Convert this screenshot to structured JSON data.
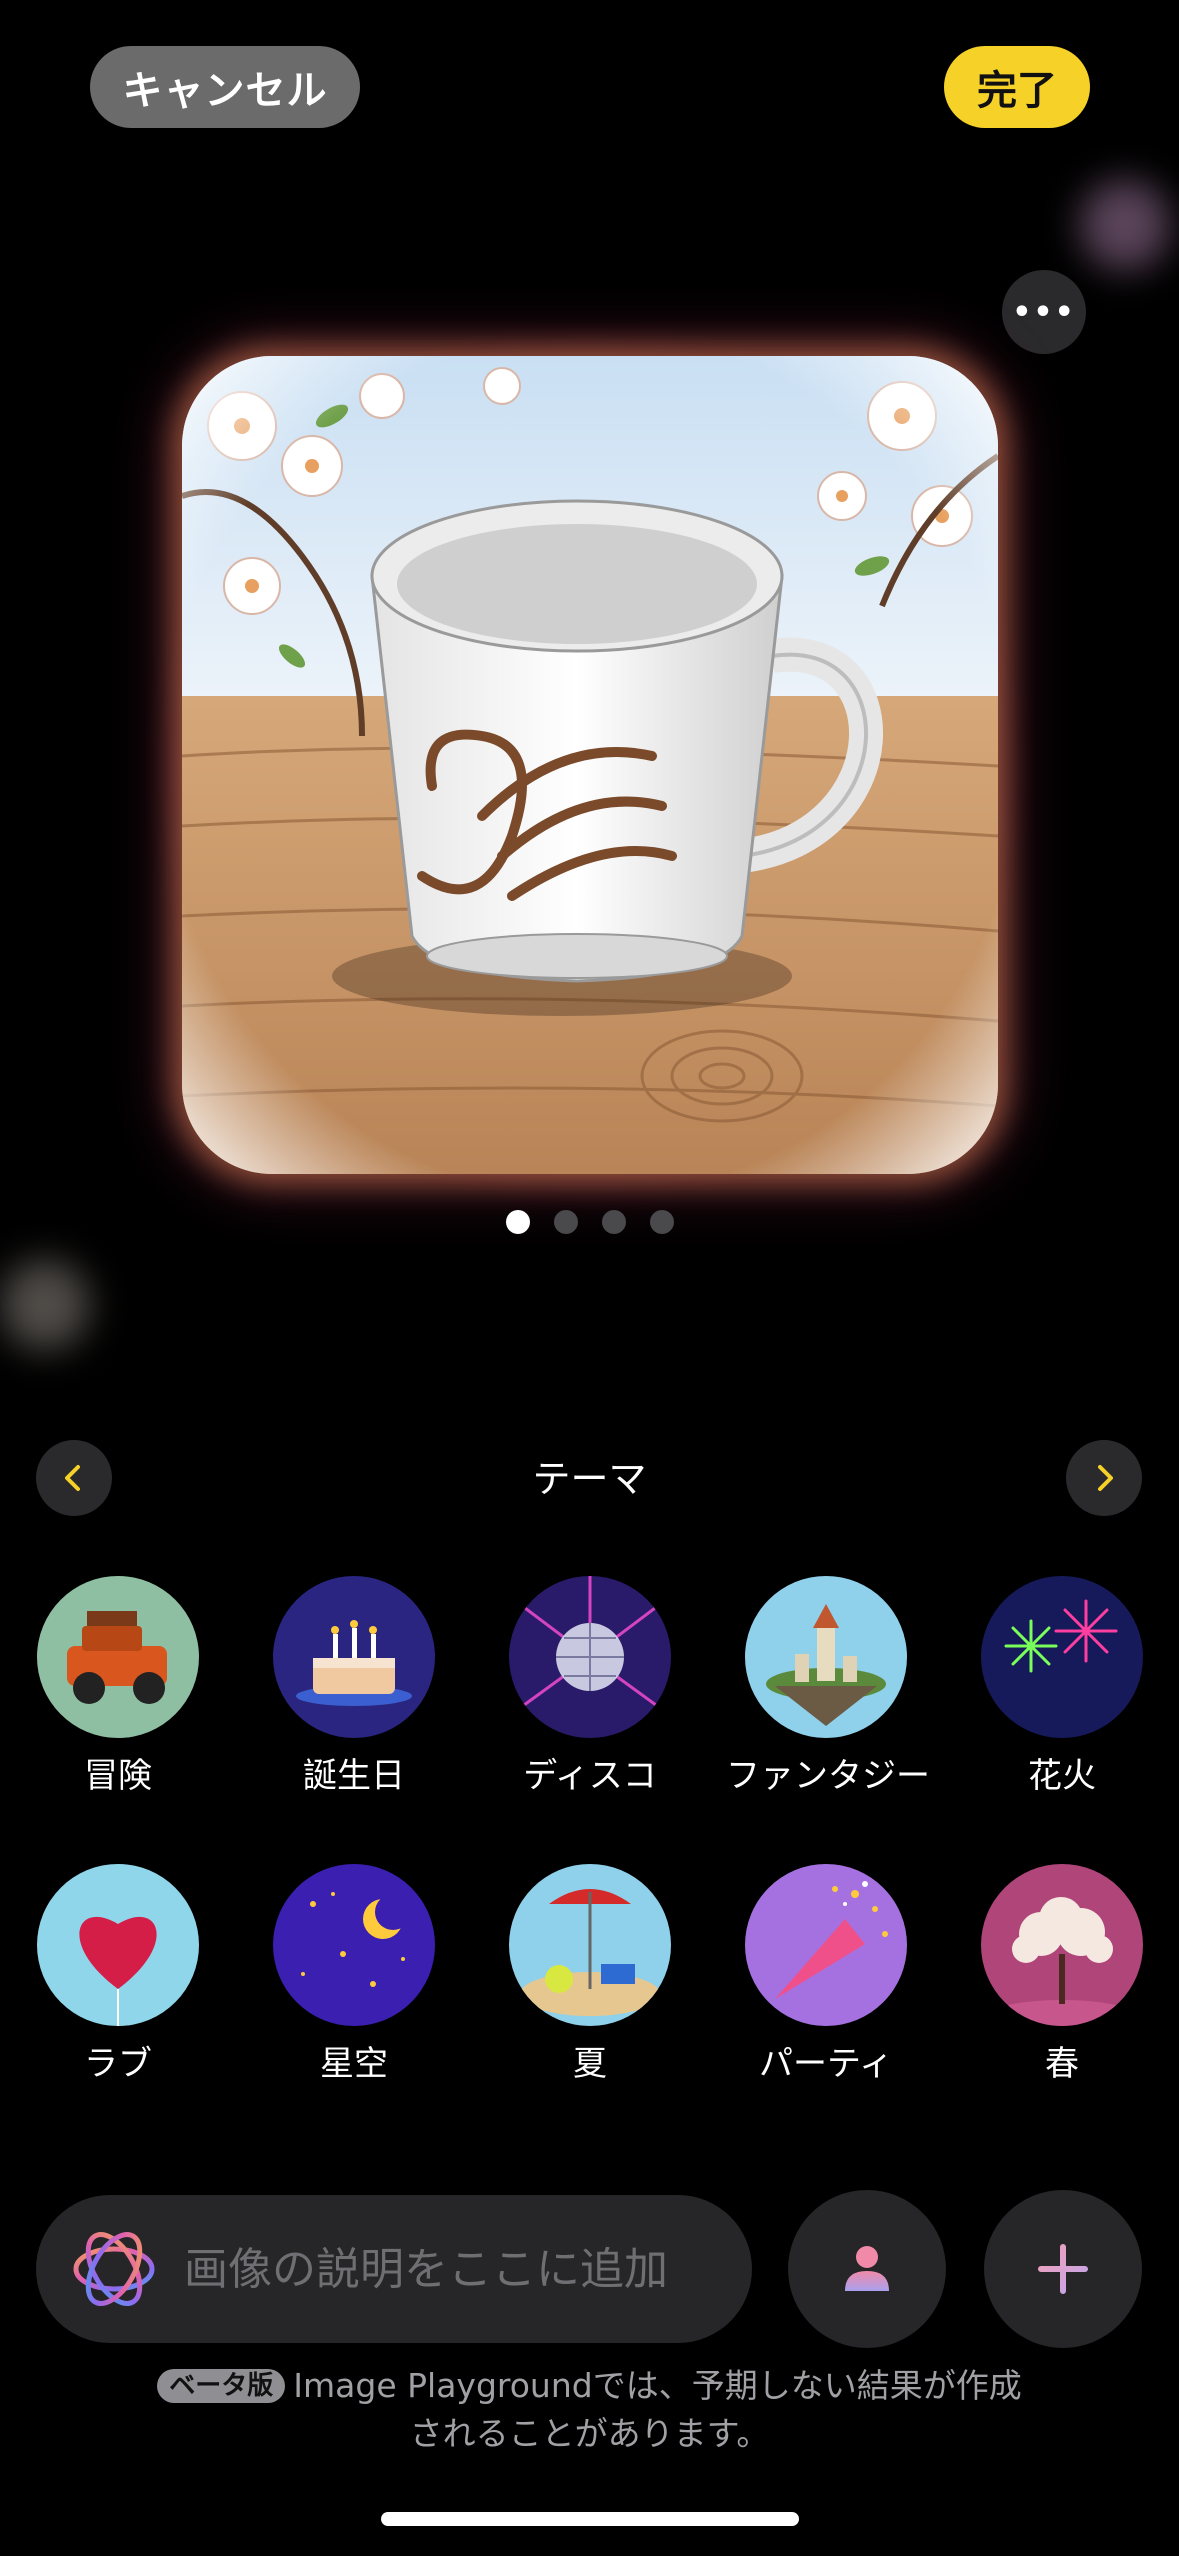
{
  "header": {
    "cancel_label": "キャンセル",
    "done_label": "完了",
    "more_label": "•••"
  },
  "preview": {
    "page_count": 4,
    "active_page": 1
  },
  "themes": {
    "title": "テーマ",
    "items": [
      {
        "label": "冒険",
        "icon": "adventure-icon"
      },
      {
        "label": "誕生日",
        "icon": "birthday-icon"
      },
      {
        "label": "ディスコ",
        "icon": "disco-icon"
      },
      {
        "label": "ファンタジー",
        "icon": "fantasy-icon"
      },
      {
        "label": "花火",
        "icon": "fireworks-icon"
      },
      {
        "label": "ラブ",
        "icon": "love-icon"
      },
      {
        "label": "星空",
        "icon": "starry-sky-icon"
      },
      {
        "label": "夏",
        "icon": "summer-icon"
      },
      {
        "label": "パーティ",
        "icon": "party-icon"
      },
      {
        "label": "春",
        "icon": "spring-icon"
      }
    ]
  },
  "prompt": {
    "placeholder": "画像の説明をここに追加"
  },
  "footer": {
    "beta_badge": "ベータ版",
    "disclaimer_line1": "Image Playgroundでは、予期しない結果が作成",
    "disclaimer_line2": "されることがあります。"
  },
  "colors": {
    "accent_yellow": "#f6d229",
    "button_gray": "#6b6b6b",
    "field_bg": "#262628",
    "background": "#000000"
  }
}
